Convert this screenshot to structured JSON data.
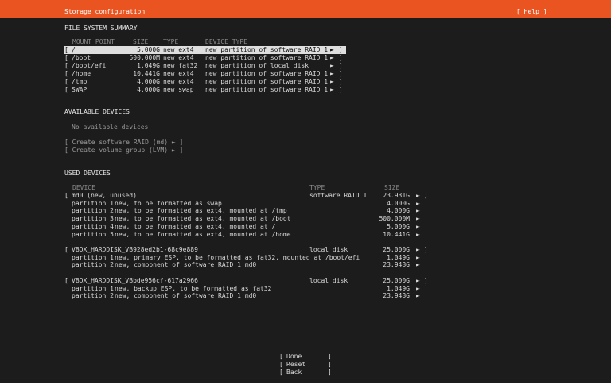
{
  "header": {
    "title": "Storage configuration",
    "help": "[ Help ]"
  },
  "fs_summary": {
    "heading": "FILE SYSTEM SUMMARY",
    "columns": {
      "mount": "MOUNT POINT",
      "size": "SIZE",
      "type": "TYPE",
      "devtype": "DEVICE TYPE"
    },
    "rows": [
      {
        "open": "[",
        "mount": "/",
        "size": "5.000G",
        "type": "new ext4",
        "devtype": "new partition of software RAID 1",
        "arrow": "►",
        "close": "]"
      },
      {
        "open": "[",
        "mount": "/boot",
        "size": "500.000M",
        "type": "new ext4",
        "devtype": "new partition of software RAID 1",
        "arrow": "►",
        "close": "]"
      },
      {
        "open": "[",
        "mount": "/boot/efi",
        "size": "1.049G",
        "type": "new fat32",
        "devtype": "new partition of local disk",
        "arrow": "►",
        "close": "]"
      },
      {
        "open": "[",
        "mount": "/home",
        "size": "10.441G",
        "type": "new ext4",
        "devtype": "new partition of software RAID 1",
        "arrow": "►",
        "close": "]"
      },
      {
        "open": "[",
        "mount": "/tmp",
        "size": "4.000G",
        "type": "new ext4",
        "devtype": "new partition of software RAID 1",
        "arrow": "►",
        "close": "]"
      },
      {
        "open": "[",
        "mount": "SWAP",
        "size": "4.000G",
        "type": "new swap",
        "devtype": "new partition of software RAID 1",
        "arrow": "►",
        "close": "]"
      }
    ]
  },
  "available": {
    "heading": "AVAILABLE DEVICES",
    "empty": "No available devices",
    "actions": [
      "[ Create software RAID (md) ► ]",
      "[ Create volume group (LVM) ► ]"
    ]
  },
  "used": {
    "heading": "USED DEVICES",
    "columns": {
      "device": "DEVICE",
      "type": "TYPE",
      "size": "SIZE"
    },
    "groups": [
      {
        "open": "[",
        "name": "md0 (new, unused)",
        "type": "software RAID 1",
        "size": "23.931G",
        "arrow": "►",
        "close": "]",
        "parts": [
          {
            "label": "partition 1",
            "desc": "new, to be formatted as swap",
            "size": "4.000G",
            "arrow": "►"
          },
          {
            "label": "partition 2",
            "desc": "new, to be formatted as ext4, mounted at /tmp",
            "size": "4.000G",
            "arrow": "►"
          },
          {
            "label": "partition 3",
            "desc": "new, to be formatted as ext4, mounted at /boot",
            "size": "500.000M",
            "arrow": "►"
          },
          {
            "label": "partition 4",
            "desc": "new, to be formatted as ext4, mounted at /",
            "size": "5.000G",
            "arrow": "►"
          },
          {
            "label": "partition 5",
            "desc": "new, to be formatted as ext4, mounted at /home",
            "size": "10.441G",
            "arrow": "►"
          }
        ]
      },
      {
        "open": "[",
        "name": "VBOX_HARDDISK_VB928ed2b1-68c9e889",
        "type": "local disk",
        "size": "25.000G",
        "arrow": "►",
        "close": "]",
        "parts": [
          {
            "label": "partition 1",
            "desc": "new, primary ESP, to be formatted as fat32, mounted at /boot/efi",
            "size": "1.049G",
            "arrow": "►"
          },
          {
            "label": "partition 2",
            "desc": "new, component of software RAID 1 md0",
            "size": "23.948G",
            "arrow": "►"
          }
        ]
      },
      {
        "open": "[",
        "name": "VBOX_HARDDISK_VBbde956cf-617a2966",
        "type": "local disk",
        "size": "25.000G",
        "arrow": "►",
        "close": "]",
        "parts": [
          {
            "label": "partition 1",
            "desc": "new, backup ESP, to be formatted as fat32",
            "size": "1.049G",
            "arrow": "►"
          },
          {
            "label": "partition 2",
            "desc": "new, component of software RAID 1 md0",
            "size": "23.948G",
            "arrow": "►"
          }
        ]
      }
    ]
  },
  "buttons": [
    {
      "open": "[",
      "label": "Done",
      "close": "]"
    },
    {
      "open": "[",
      "label": "Reset",
      "close": "]"
    },
    {
      "open": "[",
      "label": "Back",
      "close": "]"
    }
  ]
}
